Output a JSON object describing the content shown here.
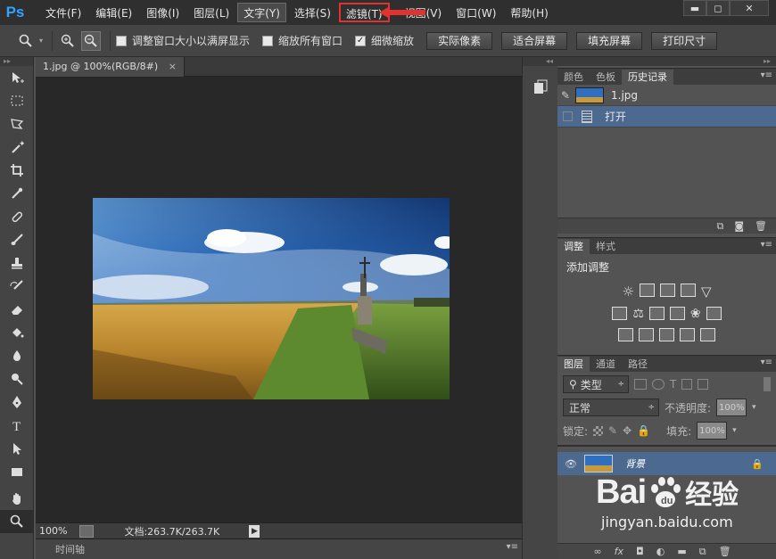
{
  "app": {
    "logo": "Ps"
  },
  "menu": [
    {
      "label": "文件(F)"
    },
    {
      "label": "编辑(E)"
    },
    {
      "label": "图像(I)"
    },
    {
      "label": "图层(L)"
    },
    {
      "label": "文字(Y)"
    },
    {
      "label": "选择(S)"
    },
    {
      "label": "滤镜(T)"
    },
    {
      "label": "视图(V)"
    },
    {
      "label": "窗口(W)"
    },
    {
      "label": "帮助(H)"
    }
  ],
  "window_buttons": {
    "minimize": "▬",
    "restore": "◻",
    "close": "✕"
  },
  "options": {
    "resize_windows": "调整窗口大小以满屏显示",
    "zoom_all": "缩放所有窗口",
    "scrubby_zoom": "细微缩放",
    "scrubby_checked": "✓",
    "btn_actual": "实际像素",
    "btn_fit": "适合屏幕",
    "btn_fill": "填充屏幕",
    "btn_print": "打印尺寸"
  },
  "document": {
    "tab_title": "1.jpg @ 100%(RGB/8#)",
    "tab_close": "×",
    "zoom": "100%",
    "doc_info": "文档:263.7K/263.7K",
    "timeline": "时间轴"
  },
  "history_panel": {
    "tabs": [
      "颜色",
      "色板",
      "历史记录"
    ],
    "snapshot": "1.jpg",
    "steps": [
      "打开"
    ]
  },
  "adjustments_panel": {
    "tabs": [
      "调整",
      "样式"
    ],
    "title": "添加调整"
  },
  "layers_panel": {
    "tabs": [
      "图层",
      "通道",
      "路径"
    ],
    "filter": "类型",
    "blend_mode": "正常",
    "opacity_label": "不透明度:",
    "opacity_value": "100%",
    "lock_label": "锁定:",
    "fill_label": "填充:",
    "fill_value": "100%",
    "layer_name": "背景"
  },
  "watermark": {
    "brand": "Bai",
    "brand_cn": "经验",
    "url": "jingyan.baidu.com"
  },
  "colors": {
    "highlight_red": "#e0322e",
    "selection_blue": "#4c6a90",
    "ps_blue": "#2fa3ff"
  }
}
